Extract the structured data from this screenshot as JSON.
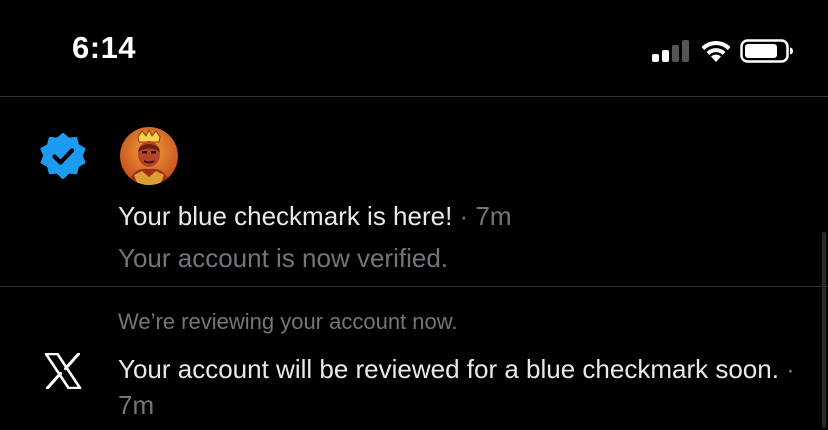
{
  "status_bar": {
    "time": "6:14",
    "signal_icon": "cellular-signal-icon",
    "wifi_icon": "wifi-icon",
    "battery_icon": "battery-icon"
  },
  "notifications": [
    {
      "type_icon": "verified-badge-icon",
      "avatar": "profile-avatar",
      "title": "Your blue checkmark is here!",
      "separator": " · ",
      "time": "7m",
      "body": "Your account is now verified."
    },
    {
      "context": "We’re reviewing your account now.",
      "type_icon": "x-logo-icon",
      "body": "Your account will be reviewed for a blue checkmark soon.",
      "separator": " · ",
      "time": "7m"
    }
  ],
  "colors": {
    "background": "#000000",
    "verified_blue": "#1d9bf0",
    "primary_text": "#e7e9ea",
    "secondary_text": "#71767b",
    "divider": "#2f3336"
  }
}
